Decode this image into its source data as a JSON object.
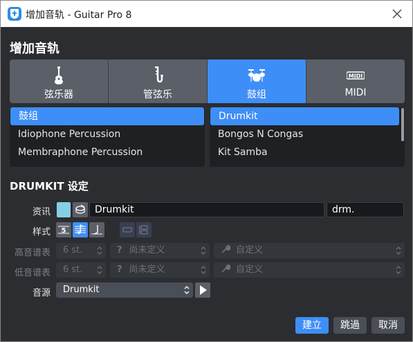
{
  "window": {
    "title": "增加音轨 - Guitar Pro 8"
  },
  "dialog": {
    "heading": "增加音轨"
  },
  "categories": [
    {
      "label": "弦乐器",
      "icon": "guitar-icon"
    },
    {
      "label": "管弦乐",
      "icon": "saxophone-icon"
    },
    {
      "label": "鼓组",
      "icon": "drum-kit-icon",
      "active": true
    },
    {
      "label": "MIDI",
      "icon": "midi-icon"
    }
  ],
  "instrument_groups": [
    "鼓组",
    "Idiophone Percussion",
    "Membraphone Percussion"
  ],
  "instruments": [
    "Drumkit",
    "Bongos N Congas",
    "Kit Samba"
  ],
  "settings": {
    "title": "DRUMKIT 设定",
    "info_label": "资讯",
    "track_name": "Drumkit",
    "short_name": "drm.",
    "swatch_color": "#86cfe6",
    "style_label": "样式",
    "treble_label": "高音谱表",
    "bass_label": "低音谱表",
    "strings_value": "6 st.",
    "tuning_value": "尚未定义",
    "custom_value": "自定义",
    "sound_label": "音源",
    "sound_value": "Drumkit"
  },
  "buttons": {
    "create": "建立",
    "skip": "跳過",
    "cancel": "取消"
  },
  "colors": {
    "accent": "#3e8ef7",
    "background": "#2b2d31"
  }
}
